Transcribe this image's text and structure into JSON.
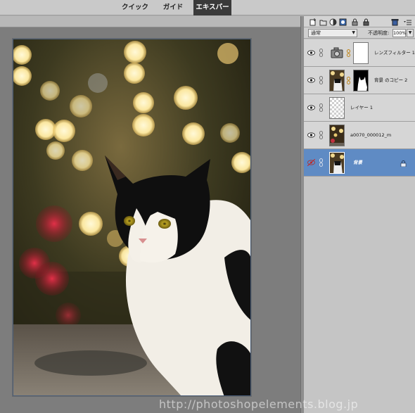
{
  "mode_tabs": [
    {
      "label": "クイック",
      "active": false
    },
    {
      "label": "ガイド",
      "active": false
    },
    {
      "label": "エキスパート",
      "active": true
    }
  ],
  "layers_panel": {
    "toolbar_icons": [
      "new-layer-icon",
      "new-group-icon",
      "adjustment-layer-icon",
      "add-mask-icon",
      "lock-transparent-icon",
      "lock-all-icon",
      "trash-icon",
      "panel-menu-icon"
    ],
    "blend_mode": "通常",
    "opacity_label": "不透明度:",
    "opacity_value": "100%",
    "layers": [
      {
        "name": "レンズフィルター 1",
        "visible": true,
        "selected": false,
        "type": "adjustment"
      },
      {
        "name": "背景 のコピー 2",
        "visible": true,
        "selected": false,
        "type": "masked-photo"
      },
      {
        "name": "レイヤー 1",
        "visible": true,
        "selected": false,
        "type": "empty"
      },
      {
        "name": "a0070_000012_m",
        "visible": true,
        "selected": false,
        "type": "photo"
      },
      {
        "name": "背景",
        "visible": false,
        "selected": true,
        "type": "background-photo"
      }
    ]
  },
  "colors": {
    "selected_layer": "#5f8bc4",
    "panel_bg": "#c5c5c5",
    "active_tab_bg": "#3a3a3a"
  },
  "watermark": "http://photoshopelements.blog.jp"
}
